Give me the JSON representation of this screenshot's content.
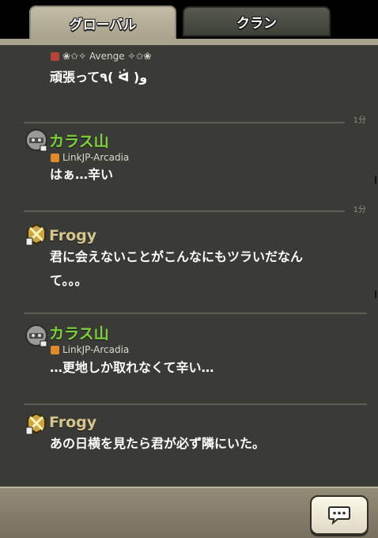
{
  "tabs": {
    "global": "グローバル",
    "clan": "クラン"
  },
  "messages": [
    {
      "clan": "❀✩✧ Avenge ✧✩❀",
      "text": "頑張って٩( ᐛ )و"
    },
    {
      "time": "1分",
      "name": "カラス山",
      "clan": "LinkJP-Arcadia",
      "text": "はぁ…辛い"
    },
    {
      "time": "1分",
      "name": "Frogy",
      "text_line1": "君に会えないことがこんなにもツラいだなん",
      "text_line2": "て。。。"
    },
    {
      "name": "カラス山",
      "clan": "LinkJP-Arcadia",
      "text": "…更地しか取れなくて辛い…"
    },
    {
      "name": "Frogy",
      "text": "あの日横を見たら君が必ず隣にいた。"
    }
  ],
  "colors": {
    "panel": "#3a3b36",
    "accent_green": "#7fd23d",
    "accent_tan": "#d6c58c",
    "tab_active": "#b6b09a"
  },
  "icons": {
    "chat_button": "speech-bubble-icon",
    "avatar_frogy": "gold-crossed-swords-icon",
    "avatar_karasu": "grey-helmet-icon"
  }
}
